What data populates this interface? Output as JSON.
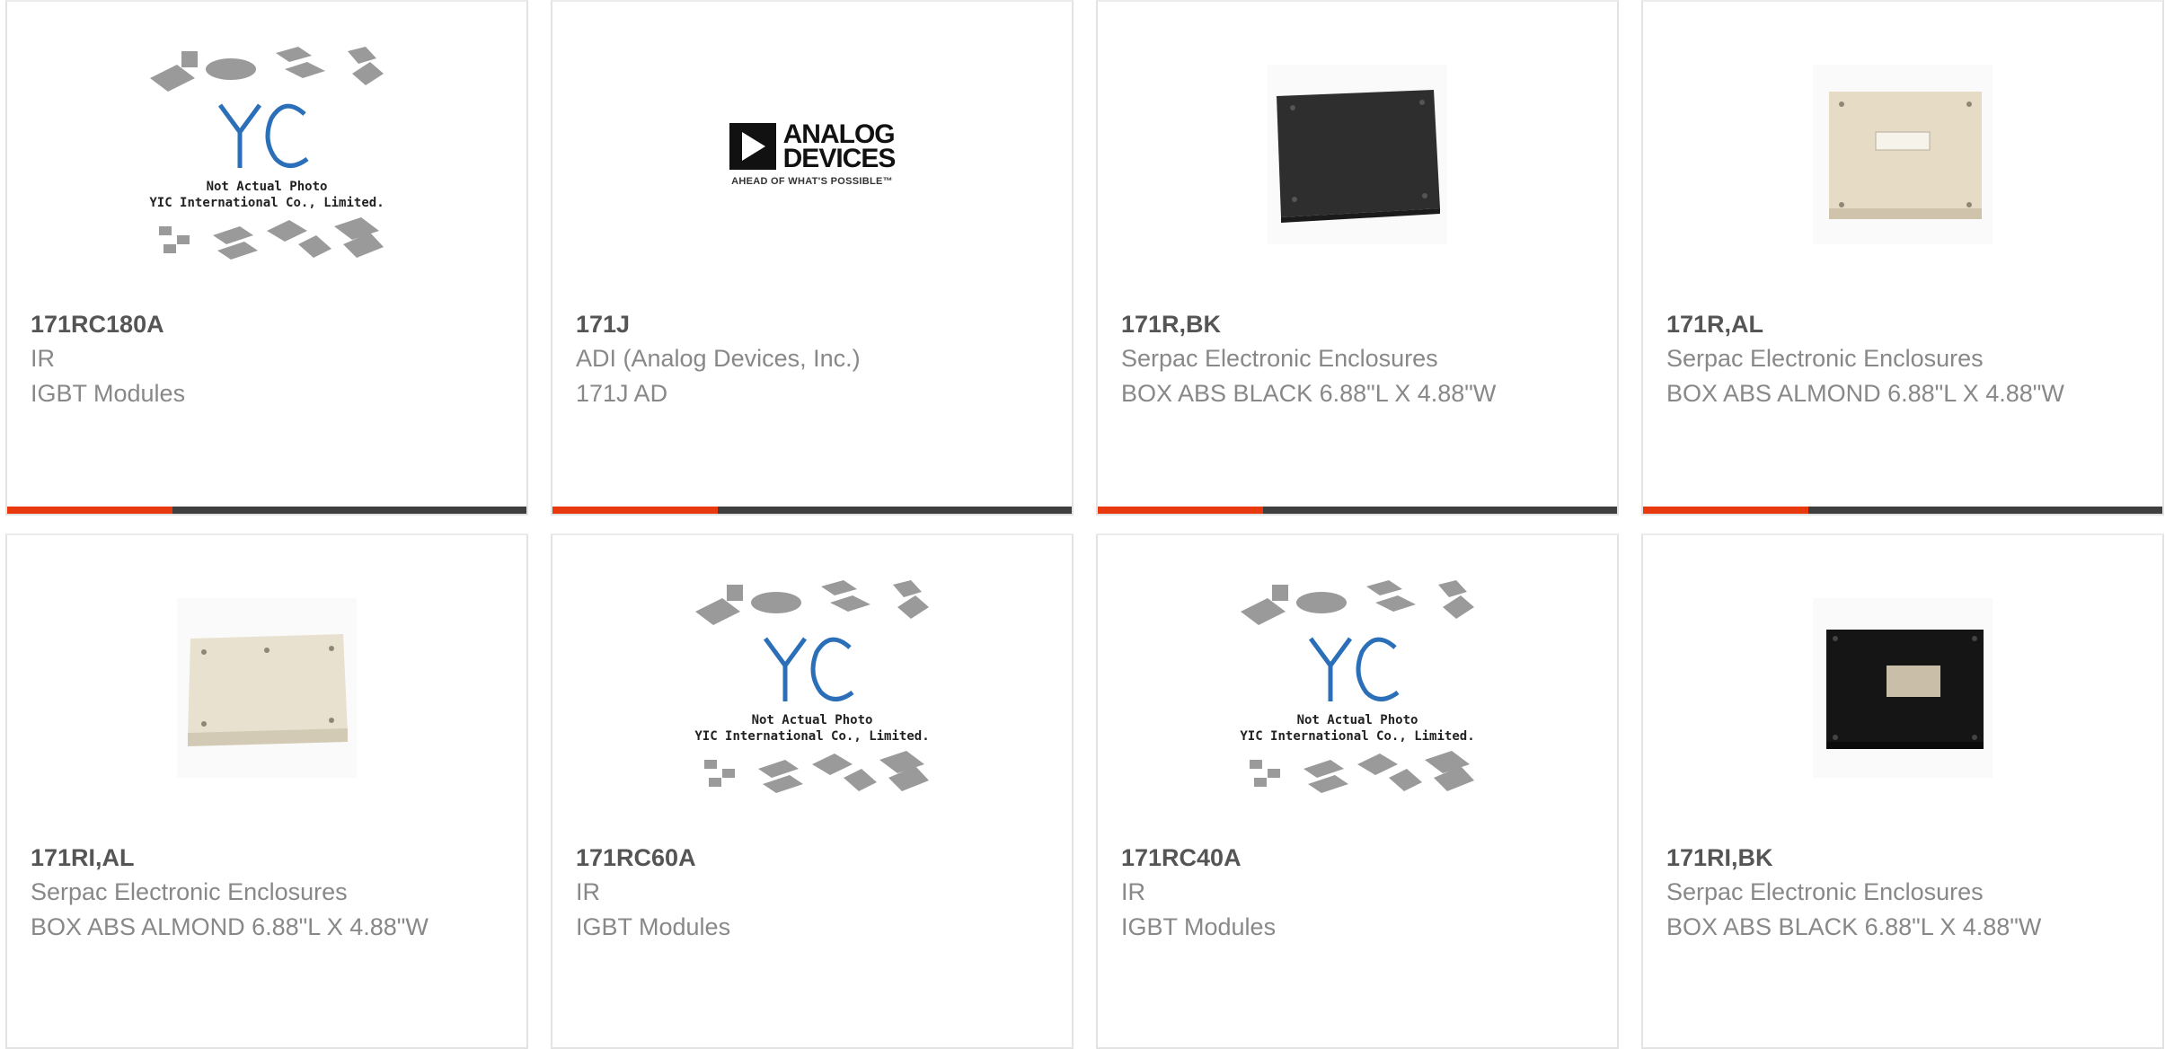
{
  "cards": [
    {
      "part": "171RC180A",
      "mfr": "IR",
      "desc": "IGBT Modules",
      "image": "placeholder-photo"
    },
    {
      "part": "171J",
      "mfr": "ADI (Analog Devices, Inc.)",
      "desc": "171J AD",
      "image": "analog-devices-logo"
    },
    {
      "part": "171R,BK",
      "mfr": "Serpac Electronic Enclosures",
      "desc": "BOX ABS BLACK 6.88\"L X 4.88\"W",
      "image": "black-enclosure-photo"
    },
    {
      "part": "171R,AL",
      "mfr": "Serpac Electronic Enclosures",
      "desc": "BOX ABS ALMOND 6.88\"L X 4.88\"W",
      "image": "almond-enclosure-photo"
    },
    {
      "part": "171RI,AL",
      "mfr": "Serpac Electronic Enclosures",
      "desc": "BOX ABS ALMOND 6.88\"L X 4.88\"W",
      "image": "almond-enclosure-photo"
    },
    {
      "part": "171RC60A",
      "mfr": "IR",
      "desc": "IGBT Modules",
      "image": "placeholder-photo"
    },
    {
      "part": "171RC40A",
      "mfr": "IR",
      "desc": "IGBT Modules",
      "image": "placeholder-photo"
    },
    {
      "part": "171RI,BK",
      "mfr": "Serpac Electronic Enclosures",
      "desc": "BOX ABS BLACK 6.88\"L X 4.88\"W",
      "image": "black-enclosure-photo"
    }
  ],
  "placeholder": {
    "line1": "Not Actual Photo",
    "line2": "YIC International Co., Limited.",
    "brand": "YIC"
  },
  "adi_logo": {
    "line1": "ANALOG",
    "line2": "DEVICES",
    "tagline": "AHEAD OF WHAT'S POSSIBLE™"
  },
  "colors": {
    "accent": "#e8390e",
    "bar": "#3f3f3f"
  }
}
